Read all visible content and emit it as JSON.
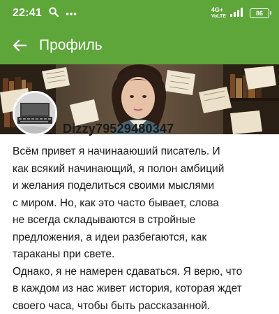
{
  "status": {
    "time": "22:41",
    "network": "4G+",
    "network_sub": "VoLTE",
    "battery": "86",
    "icons": [
      "search-icon",
      "more-dots-icon",
      "signal-icon",
      "battery-icon"
    ]
  },
  "appbar": {
    "title": "Профиль",
    "back_icon": "arrow-back-icon"
  },
  "profile": {
    "username": "Dizzy79529480347",
    "bio_lines": [
      "Всём привет я начинааюший писатель. И",
      "как всякий начинающий, я полон амбиций",
      "и желания поделиться своими мыслями",
      "с миром. Но, как это часто бывает, слова",
      "не всегда складываются в стройные",
      "предложения, а идеи разбегаются, как",
      "тараканы при свете.",
      "Однако, я не намерен сдаваться. Я верю, что",
      "в каждом из нас живет история, которая ждет",
      "своего часа, чтобы быть рассказанной."
    ]
  },
  "colors": {
    "accent": "#5ea53a",
    "text": "#1a1a1a",
    "background": "#ffffff"
  }
}
